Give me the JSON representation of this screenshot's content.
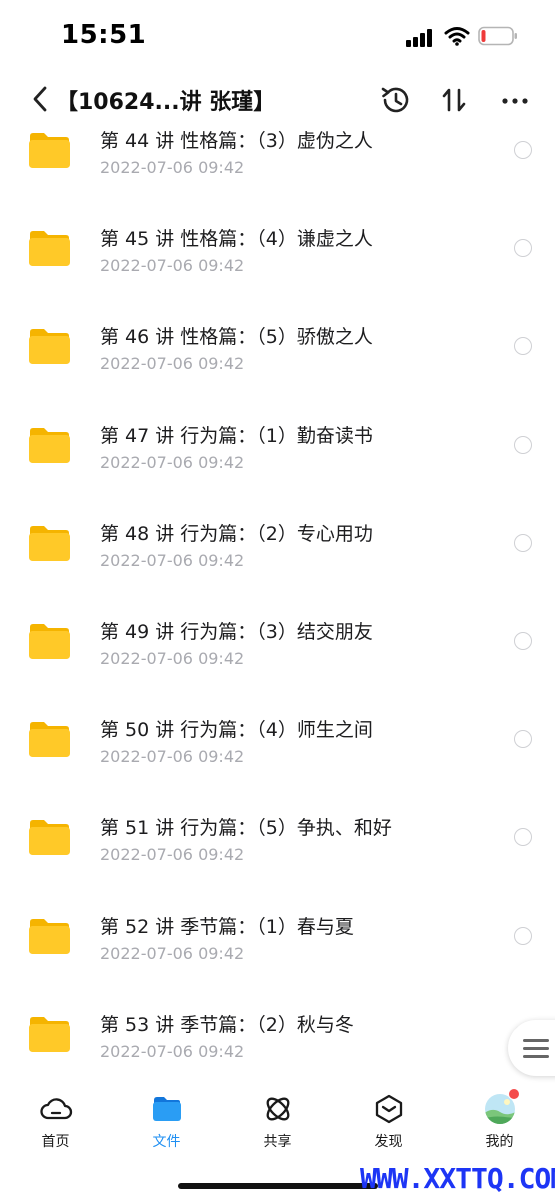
{
  "status_bar": {
    "time": "15:51",
    "icons": [
      "cellular-signal-icon",
      "wifi-icon",
      "low-battery-icon"
    ]
  },
  "header": {
    "title": "【10624...讲 张瑾】",
    "icons": [
      "back-chevron-icon",
      "history-icon",
      "sort-icon",
      "more-icon"
    ]
  },
  "files": [
    {
      "name": "第 44 讲 性格篇：（3）虚伪之人",
      "date": "2022-07-06 09:42"
    },
    {
      "name": "第 45 讲 性格篇：（4）谦虚之人",
      "date": "2022-07-06 09:42"
    },
    {
      "name": "第 46 讲 性格篇：（5）骄傲之人",
      "date": "2022-07-06 09:42"
    },
    {
      "name": "第 47 讲 行为篇：（1）勤奋读书",
      "date": "2022-07-06 09:42"
    },
    {
      "name": "第 48 讲 行为篇：（2）专心用功",
      "date": "2022-07-06 09:42"
    },
    {
      "name": "第 49 讲 行为篇：（3）结交朋友",
      "date": "2022-07-06 09:42"
    },
    {
      "name": "第 50 讲 行为篇：（4）师生之间",
      "date": "2022-07-06 09:42"
    },
    {
      "name": "第 51 讲 行为篇：（5）争执、和好",
      "date": "2022-07-06 09:42"
    },
    {
      "name": "第 52 讲 季节篇：（1）春与夏",
      "date": "2022-07-06 09:42"
    },
    {
      "name": "第 53 讲 季节篇：（2）秋与冬",
      "date": "2022-07-06 09:42"
    }
  ],
  "tab_bar": {
    "tabs": [
      {
        "label": "首页",
        "icon": "cloud-icon"
      },
      {
        "label": "文件",
        "icon": "folder-icon",
        "active": true
      },
      {
        "label": "共享",
        "icon": "atom-share-icon"
      },
      {
        "label": "发现",
        "icon": "discover-box-icon"
      },
      {
        "label": "我的",
        "icon": "avatar-icon",
        "badge": true
      }
    ]
  },
  "watermark": "WWW.XXTTQ.COM",
  "colors": {
    "accent": "#1f8ff2",
    "folder": "#ffc928",
    "date_text": "#a9aab0",
    "badge": "#f44b4b",
    "watermark": "#1d35f5"
  }
}
